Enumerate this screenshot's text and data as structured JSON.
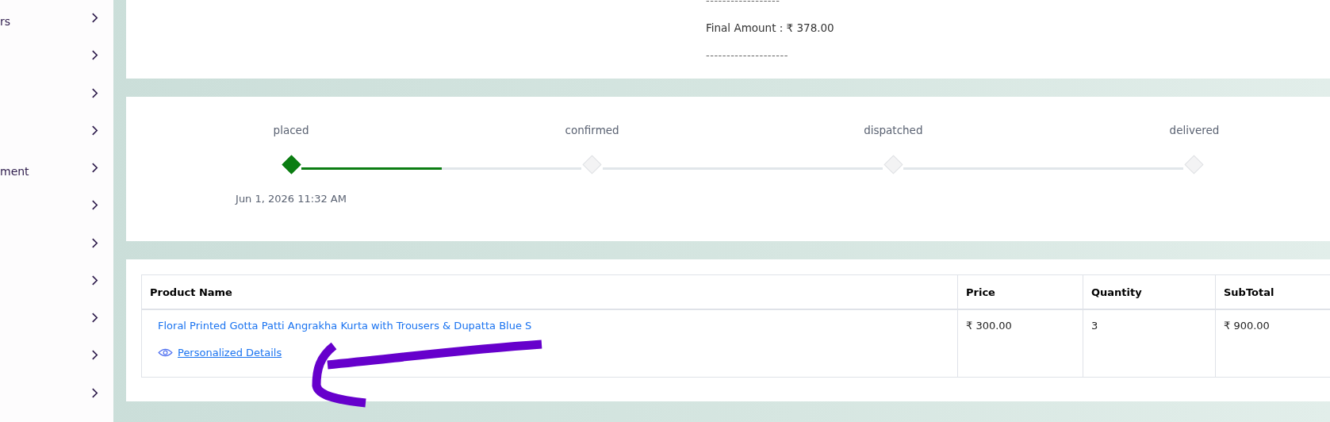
{
  "sidebar": {
    "items": [
      {
        "label": "rs",
        "expandable": true
      },
      {
        "expandable": true
      },
      {
        "expandable": true
      },
      {
        "expandable": true
      },
      {
        "label": "ment",
        "expandable": true
      },
      {
        "expandable": true
      },
      {
        "expandable": true
      },
      {
        "expandable": true
      },
      {
        "expandable": true
      },
      {
        "expandable": true
      },
      {
        "expandable": true
      }
    ]
  },
  "summary": {
    "divider_top": "------------------",
    "final_amount": "Final Amount : ₹  378.00",
    "divider_bottom": "--------------------"
  },
  "timeline": {
    "steps": [
      {
        "label": "placed",
        "done": true,
        "date": "Jun 1, 2026 11:32 AM",
        "level": 0.5
      },
      {
        "label": "confirmed",
        "done": false
      },
      {
        "label": "dispatched",
        "done": false
      },
      {
        "label": "delivered",
        "done": false
      }
    ]
  },
  "table": {
    "columns": [
      "Product Name",
      "Price",
      "Quantity",
      "SubTotal"
    ],
    "rows": [
      {
        "product": "Floral Printed Gotta Patti Angrakha Kurta with Trousers & Dupatta Blue S",
        "link": "Personalized Details",
        "price": "₹ 300.00",
        "quantity": "3",
        "subtotal": "₹ 900.00"
      }
    ]
  }
}
